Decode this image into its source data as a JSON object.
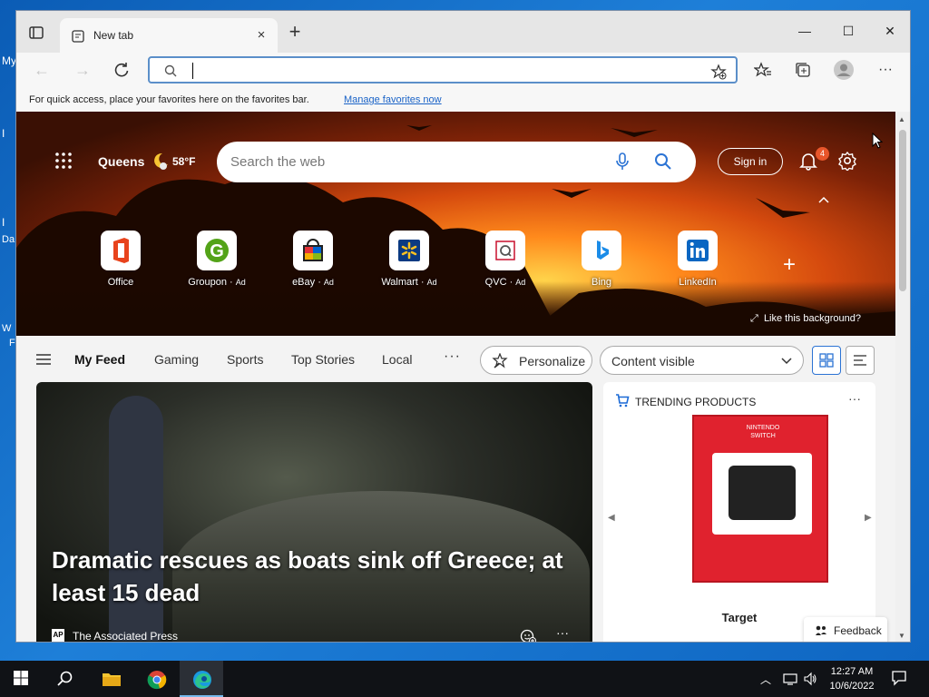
{
  "desktop": {
    "labels": [
      "My",
      "I",
      "I",
      "Da",
      "W",
      "F"
    ]
  },
  "browser": {
    "tab_title": "New tab",
    "close_tab": "×",
    "new_tab": "+",
    "window_buttons": {
      "minimize": "—",
      "maximize": "☐",
      "close": "✕"
    },
    "address_value": "",
    "favbar_hint": "For quick access, place your favorites here on the favorites bar.",
    "favbar_link": "Manage favorites now"
  },
  "newtab": {
    "weather": {
      "city": "Queens",
      "temp": "58°F"
    },
    "search_placeholder": "Search the web",
    "sign_in": "Sign in",
    "notification_count": "4",
    "tiles": [
      {
        "label": "Office",
        "ad": ""
      },
      {
        "label": "Groupon",
        "ad": "Ad"
      },
      {
        "label": "eBay",
        "ad": "Ad"
      },
      {
        "label": "Walmart",
        "ad": "Ad"
      },
      {
        "label": "QVC",
        "ad": "Ad"
      },
      {
        "label": "Bing",
        "ad": ""
      },
      {
        "label": "LinkedIn",
        "ad": ""
      }
    ],
    "add_tile": "+",
    "like_background": "Like this background?",
    "feed_tabs": [
      "My Feed",
      "Gaming",
      "Sports",
      "Top Stories",
      "Local"
    ],
    "more": "···",
    "personalize": "Personalize",
    "content_visibility": "Content visible",
    "hero_story": {
      "headline": "Dramatic rescues as boats sink off Greece; at least 15 dead",
      "source_logo": "AP",
      "source": "The Associated Press",
      "more": "···"
    },
    "trending": {
      "heading": "TRENDING PRODUCTS",
      "more": "···",
      "product_box_text": "NINTENDO SWITCH",
      "retailer": "Target"
    },
    "feedback": "Feedback"
  },
  "taskbar": {
    "time": "12:27 AM",
    "date": "10/6/2022"
  },
  "colors": {
    "accent": "#2b73d4",
    "taskbar": "#101216",
    "badge": "#e8562b"
  }
}
